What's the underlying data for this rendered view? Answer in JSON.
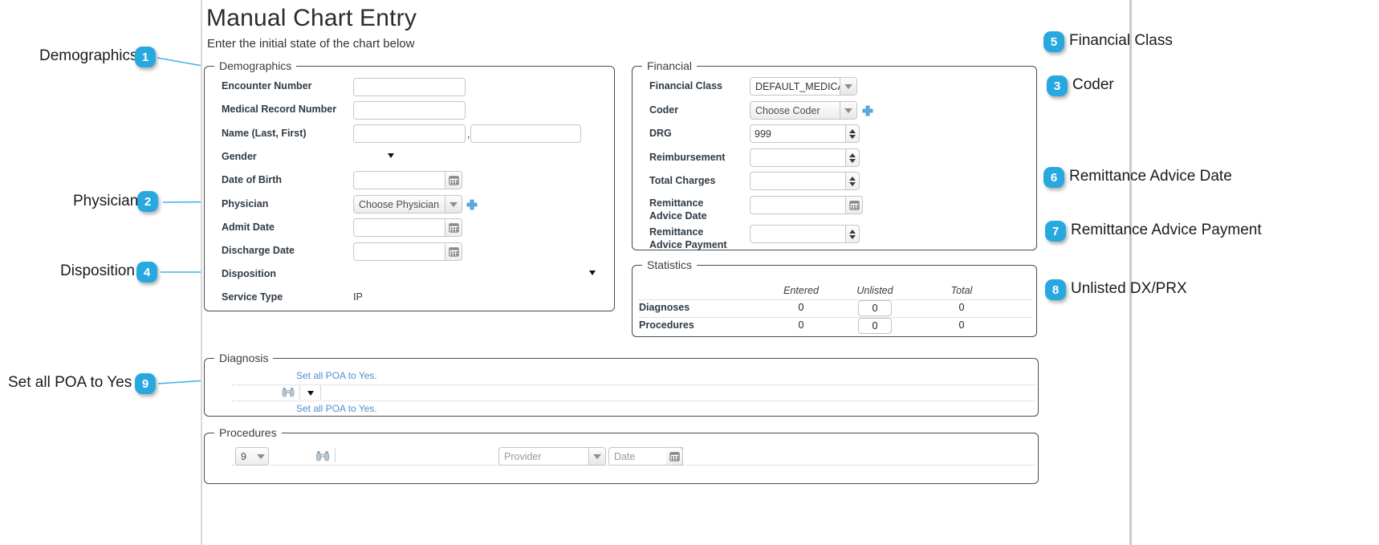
{
  "app": {
    "title": "Manual Chart Entry",
    "subtitle": "Enter the initial state of the chart below"
  },
  "demographics": {
    "legend": "Demographics",
    "fields": {
      "encounter_number": {
        "label": "Encounter Number",
        "value": ""
      },
      "medical_record_number": {
        "label": "Medical Record Number",
        "value": ""
      },
      "name": {
        "label": "Name (Last, First)",
        "last": "",
        "first": "",
        "separator": ","
      },
      "gender": {
        "label": "Gender",
        "value": ""
      },
      "date_of_birth": {
        "label": "Date of Birth",
        "value": ""
      },
      "physician": {
        "label": "Physician",
        "value": "Choose Physician"
      },
      "admit_date": {
        "label": "Admit Date",
        "value": ""
      },
      "discharge_date": {
        "label": "Discharge Date",
        "value": ""
      },
      "disposition": {
        "label": "Disposition",
        "value": ""
      },
      "service_type": {
        "label": "Service Type",
        "value": "IP"
      }
    }
  },
  "financial": {
    "legend": "Financial",
    "fields": {
      "financial_class": {
        "label": "Financial Class",
        "value": "DEFAULT_MEDICAR"
      },
      "coder": {
        "label": "Coder",
        "value": "Choose Coder"
      },
      "drg": {
        "label": "DRG",
        "value": "999"
      },
      "reimbursement": {
        "label": "Reimbursement",
        "value": ""
      },
      "total_charges": {
        "label": "Total Charges",
        "value": ""
      },
      "remittance_advice_date": {
        "label_line1": "Remittance",
        "label_line2": "Advice Date",
        "value": ""
      },
      "remittance_advice_payment": {
        "label_line1": "Remittance",
        "label_line2": "Advice Payment",
        "value": ""
      }
    }
  },
  "statistics": {
    "legend": "Statistics",
    "columns": [
      "Entered",
      "Unlisted",
      "Total"
    ],
    "rows": [
      {
        "name": "Diagnoses",
        "entered": "0",
        "unlisted": "0",
        "total": "0"
      },
      {
        "name": "Procedures",
        "entered": "0",
        "unlisted": "0",
        "total": "0"
      }
    ]
  },
  "diagnosis": {
    "legend": "Diagnosis",
    "poa_link_top": "Set all POA to Yes.",
    "poa_link_bottom": "Set all POA to Yes."
  },
  "procedures": {
    "legend": "Procedures",
    "code_version": "9",
    "provider_placeholder": "Provider",
    "date_placeholder": "Date"
  },
  "callouts": [
    {
      "num": "1",
      "label": "Demographics"
    },
    {
      "num": "2",
      "label": "Physician"
    },
    {
      "num": "4",
      "label": "Disposition"
    },
    {
      "num": "9",
      "label": "Set all POA to Yes"
    },
    {
      "num": "5",
      "label": "Financial Class"
    },
    {
      "num": "3",
      "label": "Coder"
    },
    {
      "num": "6",
      "label": "Remittance Advice Date"
    },
    {
      "num": "7",
      "label": "Remittance Advice Payment"
    },
    {
      "num": "8",
      "label": "Unlisted DX/PRX"
    }
  ],
  "colors": {
    "callout_badge": "#27a9e0",
    "leader_line": "#3fb4e8",
    "link": "#4d8fd1"
  }
}
